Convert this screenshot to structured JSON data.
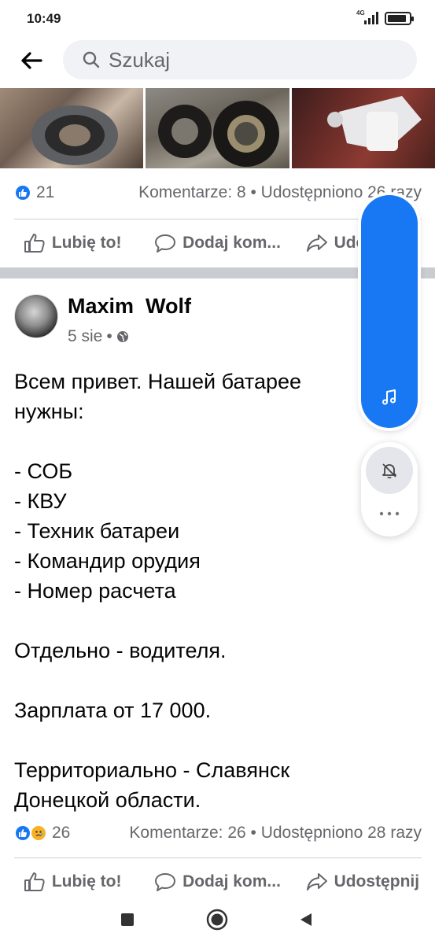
{
  "status_bar": {
    "time": "10:49",
    "network": "4G",
    "battery_level": 0.9
  },
  "search": {
    "placeholder": "Szukaj"
  },
  "prev_post": {
    "likes": "21",
    "stats": "Komentarze: 8 • Udostępniono 26 razy",
    "actions": {
      "like": "Lubię to!",
      "comment": "Dodaj kom...",
      "share": "Udostępnij"
    }
  },
  "post": {
    "author": "Maxim  Wolf",
    "date": "5 sie",
    "body": [
      "Всем привет. Нашей батарее",
      "нужны:",
      "",
      "- СОБ",
      "- КВУ",
      "- Техник батареи",
      "- Командир орудия",
      "- Номер расчета",
      "",
      "Отдельно - водителя.",
      "",
      "Зарплата от 17 000.",
      "",
      "Территориально - Славянск",
      "Донецкой области."
    ],
    "reactions_count": "26",
    "stats": "Komentarze: 26 • Udostępniono 28 razy",
    "actions": {
      "like": "Lubię to!",
      "comment": "Dodaj kom...",
      "share": "Udostępnij"
    }
  },
  "colors": {
    "accent": "#1877f2",
    "muted": "#65676b",
    "sad": "#f7b125"
  }
}
